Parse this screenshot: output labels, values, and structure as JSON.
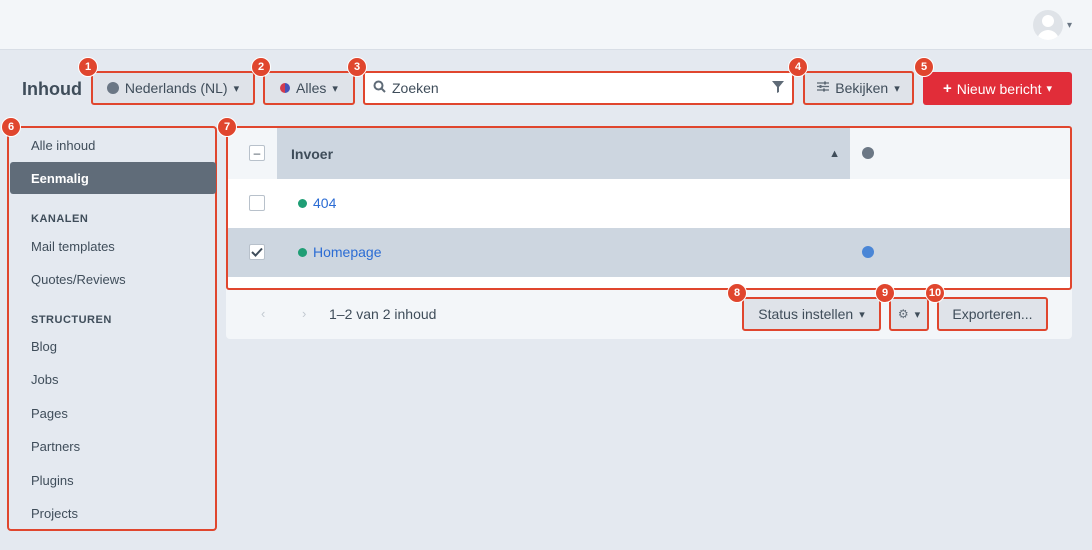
{
  "topbar": {
    "user_menu": "user-avatar"
  },
  "page": {
    "title": "Inhoud"
  },
  "toolbar": {
    "language_label": "Nederlands (NL)",
    "status_label": "Alles",
    "search_placeholder": "Zoeken",
    "view_label": "Bekijken",
    "new_label": "Nieuw bericht"
  },
  "sidebar": {
    "items": [
      {
        "label": "Alle inhoud"
      },
      {
        "label": "Eenmalig",
        "active": true
      }
    ],
    "channels_heading": "KANALEN",
    "channels": [
      {
        "label": "Mail templates"
      },
      {
        "label": "Quotes/Reviews"
      }
    ],
    "structures_heading": "STRUCTUREN",
    "structures": [
      {
        "label": "Blog"
      },
      {
        "label": "Jobs"
      },
      {
        "label": "Pages"
      },
      {
        "label": "Partners"
      },
      {
        "label": "Plugins"
      },
      {
        "label": "Projects"
      }
    ]
  },
  "table": {
    "column_title": "Invoer",
    "rows": [
      {
        "title": "404",
        "checked": false,
        "status_color": "#1f9e75",
        "has_site_icon": false
      },
      {
        "title": "Homepage",
        "checked": true,
        "status_color": "#1f9e75",
        "has_site_icon": true
      }
    ]
  },
  "footer": {
    "pagination_text": "1–2 van 2 inhoud",
    "set_status_label": "Status instellen",
    "export_label": "Exporteren..."
  },
  "badges": [
    "1",
    "2",
    "3",
    "4",
    "5",
    "6",
    "7",
    "8",
    "9",
    "10"
  ],
  "colors": {
    "accent_red": "#e12d39",
    "annotation": "#e0462e",
    "link": "#2b6cd4",
    "live_status": "#1f9e75"
  }
}
